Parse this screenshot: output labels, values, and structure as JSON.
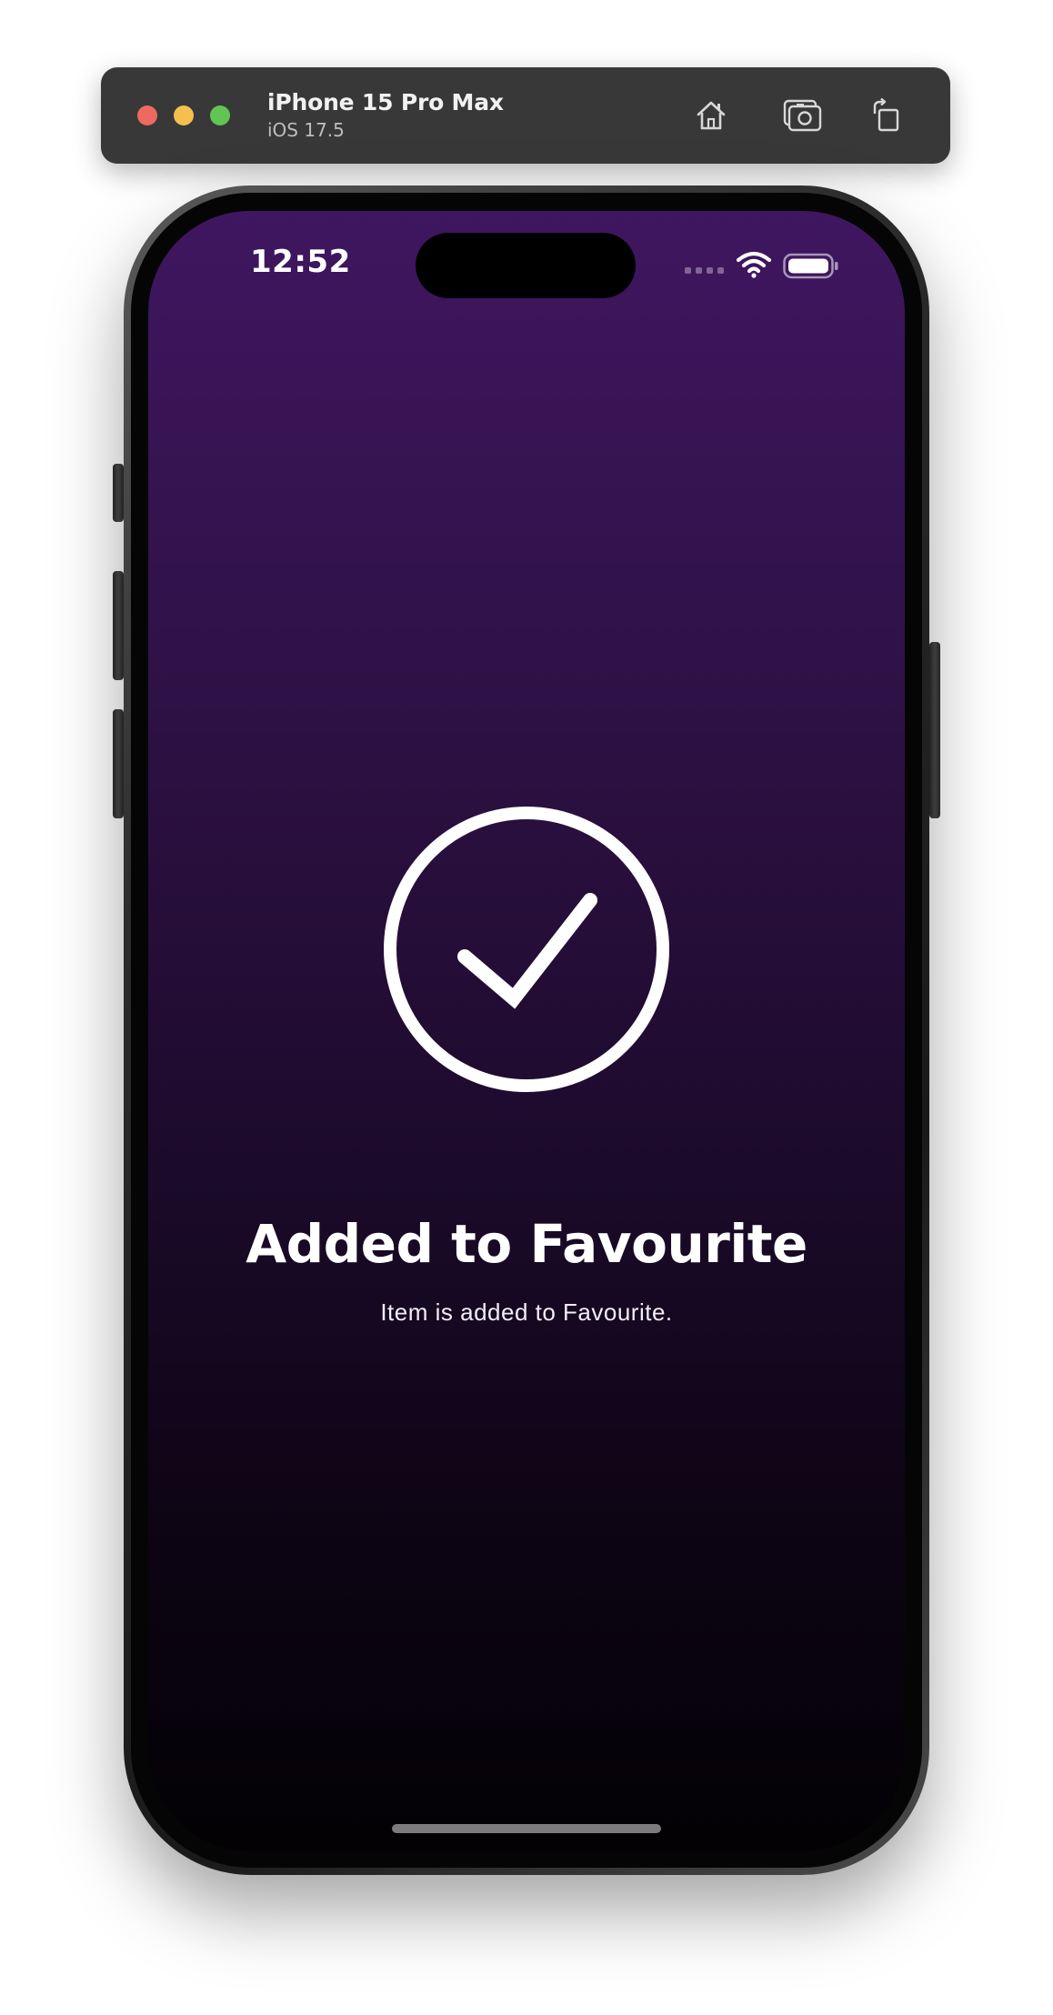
{
  "simulator": {
    "device_name": "iPhone 15 Pro Max",
    "os_version": "iOS 17.5",
    "toolbar_icons": [
      "home-icon",
      "screenshot-icon",
      "rotate-icon"
    ]
  },
  "status_bar": {
    "time": "12:52",
    "icons": [
      "signal-icon",
      "wifi-icon",
      "battery-icon"
    ]
  },
  "success": {
    "icon": "checkmark-circle-icon",
    "title": "Added to Favourite",
    "message": "Item is added to Favourite."
  },
  "colors": {
    "gradient_top": "#3f1660",
    "gradient_bottom": "#030104",
    "text": "#ffffff"
  }
}
